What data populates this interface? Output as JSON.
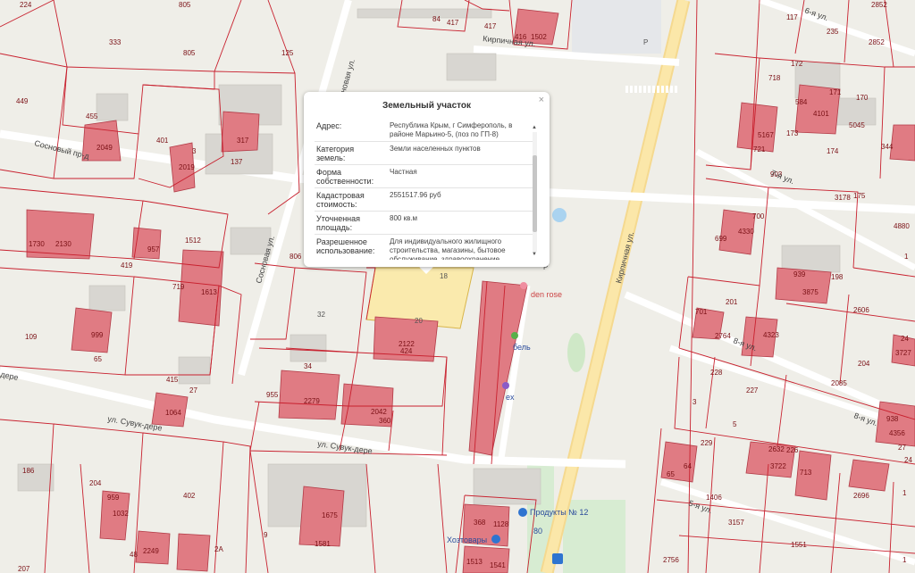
{
  "popup": {
    "title": "Земельный участок",
    "close": "×",
    "rows": [
      {
        "key": "Адрес:",
        "value": "Республика Крым, г Симферополь, в районе Марьино-5, (поз по ГП-8)"
      },
      {
        "key": "Категория земель:",
        "value": "Земли населенных пунктов"
      },
      {
        "key": "Форма собственности:",
        "value": "Частная"
      },
      {
        "key": "Кадастровая стоимость:",
        "value": "2551517.96 руб"
      },
      {
        "key": "Уточненная площадь:",
        "value": "800 кв.м"
      },
      {
        "key": "Разрешенное использование:",
        "value": "Для индивидуального жилищного строительства, магазины, бытовое обслуживание, здравоохранение"
      }
    ]
  },
  "streets": {
    "sosnovy_pr": "Сосновый пр-д",
    "sosnovaya_top": "Сосновая ул.",
    "sosnovaya_mid": "Сосновая ул.",
    "kirpichnaya_top": "Кирпичная ул.",
    "kirpichnaya_main": "Кирпичная ул.",
    "sevk_dere_1": "ул. Сувук-дере",
    "sevk_dere_2": "ул. Сувук-дере",
    "dere_left": "дере",
    "ul7": "7-я ул.",
    "ul8": "8-я ул.",
    "ul8b": "8-я ул.",
    "ul6": "6-я ул.",
    "ul5": "5-я ул."
  },
  "pois": {
    "garden": "den rose",
    "bel": "бель",
    "ex": "ex",
    "products": "Продукты № 12",
    "hoz": "Хозтовары",
    "parking1": "P",
    "parking2": "P"
  },
  "parcel_labels": [
    "224",
    "805",
    "333",
    "805",
    "125",
    "449",
    "455",
    "2049",
    "401",
    "317",
    "137",
    "3",
    "2019",
    "1730",
    "2130",
    "957",
    "419",
    "1512",
    "719",
    "1613",
    "109",
    "999",
    "65",
    "415",
    "27",
    "1064",
    "955",
    "2279",
    "34",
    "2042",
    "360",
    "2122",
    "424",
    "20",
    "32",
    "18",
    "806",
    "186",
    "204",
    "959",
    "1032",
    "48",
    "2249",
    "402",
    "9",
    "2A",
    "1675",
    "1581",
    "207",
    "368",
    "1128",
    "1513",
    "1541",
    "84",
    "417",
    "417",
    "416",
    "1502",
    "172",
    "718",
    "584",
    "4101",
    "171",
    "170",
    "5045",
    "5167",
    "721",
    "173",
    "903",
    "174",
    "3178",
    "175",
    "344",
    "700",
    "699",
    "4330",
    "939",
    "3875",
    "198",
    "201",
    "701",
    "2764",
    "4323",
    "2606",
    "228",
    "227",
    "2085",
    "204",
    "24",
    "3727",
    "3",
    "5",
    "229",
    "2632",
    "226",
    "3722",
    "713",
    "1406",
    "3157",
    "1551",
    "117",
    "235",
    "2852",
    "2852",
    "4880",
    "1",
    "24",
    "938",
    "4356",
    "2696",
    "1",
    "65",
    "64",
    "27",
    "2756",
    "1",
    "80"
  ]
}
